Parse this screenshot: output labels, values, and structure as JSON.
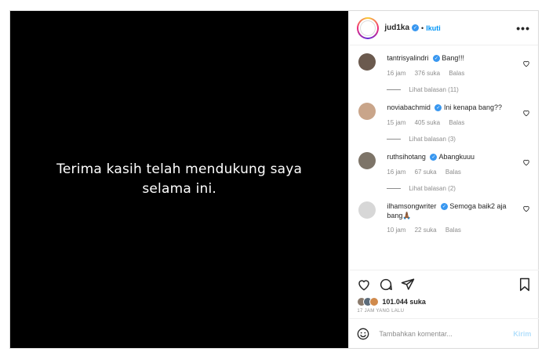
{
  "media": {
    "caption_text": "Terima kasih telah mendukung saya selama ini."
  },
  "header": {
    "username": "jud1ka",
    "separator": "•",
    "follow_label": "Ikuti",
    "more_label": "•••"
  },
  "comments": [
    {
      "username": "tantrisyalindri",
      "text": "Bang!!!",
      "time": "16 jam",
      "likes": "376 suka",
      "reply": "Balas",
      "view_replies": "Lihat balasan (11)",
      "avatar_color": "#6b5a4e"
    },
    {
      "username": "noviabachmid",
      "text": "Ini kenapa bang??",
      "time": "15 jam",
      "likes": "405 suka",
      "reply": "Balas",
      "view_replies": "Lihat balasan (3)",
      "avatar_color": "#c9a58a"
    },
    {
      "username": "ruthsihotang",
      "text": "Abangkuuu",
      "time": "16 jam",
      "likes": "67 suka",
      "reply": "Balas",
      "view_replies": "Lihat balasan (2)",
      "avatar_color": "#7d7468"
    },
    {
      "username": "ilhamsongwriter",
      "text": "Semoga baik2 aja bang🙏🏾",
      "time": "10 jam",
      "likes": "22 suka",
      "reply": "Balas",
      "view_replies": "",
      "avatar_color": "#d7d7d7"
    }
  ],
  "actions": {
    "likes_count": "101.044",
    "likes_suffix": " suka",
    "time_ago": "17 JAM YANG LALU",
    "liker_colors": [
      "#8a7a6c",
      "#5b6b7a",
      "#d08a4c"
    ]
  },
  "add_comment": {
    "placeholder": "Tambahkan komentar...",
    "post_label": "Kirim"
  },
  "colors": {
    "accent": "#0095f6",
    "verified": "#3897f0",
    "muted": "#8e8e8e",
    "border": "#dbdbdb"
  }
}
